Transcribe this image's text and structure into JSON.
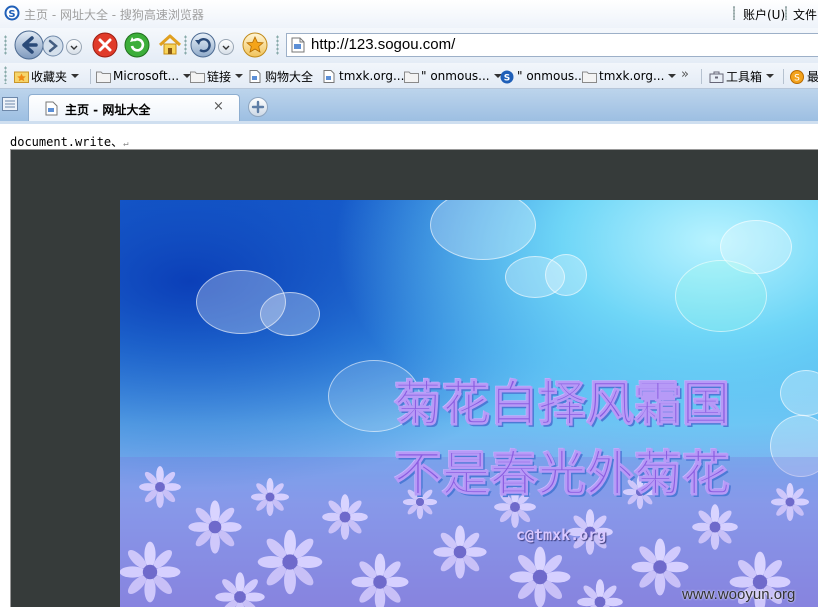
{
  "window": {
    "title": "主页 - 网址大全 - 搜狗高速浏览器",
    "menu_account": "账户(U)",
    "menu_file": "文件("
  },
  "navbar": {
    "url": "http://123.sogou.com/"
  },
  "favorites": [
    {
      "label": "收藏夹",
      "icon": "star-folder-icon",
      "dropdown": true
    },
    {
      "label": "Microsoft...",
      "icon": "folder-icon",
      "dropdown": true
    },
    {
      "label": "链接",
      "icon": "folder-icon",
      "dropdown": true
    },
    {
      "label": "购物大全",
      "icon": "page-icon",
      "dropdown": false
    },
    {
      "label": "tmxk.org...",
      "icon": "page-icon",
      "dropdown": false
    },
    {
      "label": "\" onmous...",
      "icon": "folder-icon",
      "dropdown": true
    },
    {
      "label": "\" onmous...",
      "icon": "sogou-icon",
      "dropdown": false
    },
    {
      "label": "tmxk.org...",
      "icon": "folder-icon",
      "dropdown": true
    },
    {
      "label": "工具箱",
      "icon": "toolbox-icon",
      "dropdown": true
    },
    {
      "label": "最",
      "icon": "orange-icon",
      "dropdown": false
    }
  ],
  "favorites_more": "»",
  "tab": {
    "label": "主页 - 网址大全",
    "close": "×"
  },
  "content": {
    "doc_text": "document.write、",
    "poem_line1": "菊花白择风霜国",
    "poem_line2": "不是春光外菊花",
    "credit": "c@tmxk.org"
  },
  "watermark": "www.wooyun.org",
  "colors": {
    "poem": "#8a5ce0",
    "frame": "#363b3a",
    "tabstrip": "#9dbfe2"
  }
}
